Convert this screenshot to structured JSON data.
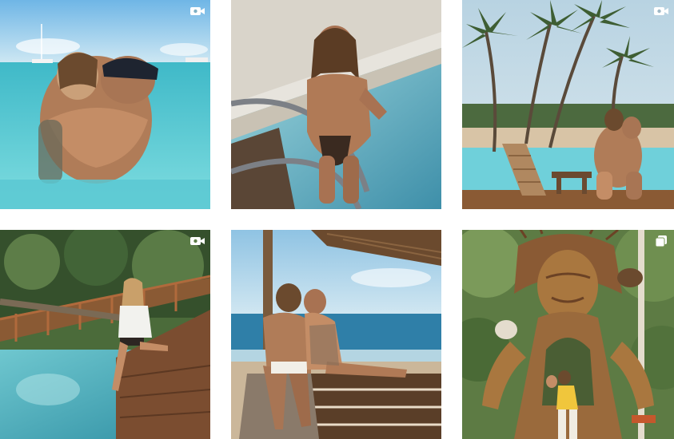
{
  "grid": {
    "posts": [
      {
        "scene": "couple-kissing-in-turquoise-sea",
        "badge": "video-icon"
      },
      {
        "scene": "woman-on-pool-ladder",
        "badge": ""
      },
      {
        "scene": "couple-at-palm-tree-pool",
        "badge": "video-icon"
      },
      {
        "scene": "woman-on-wooden-jungle-bridge",
        "badge": "video-icon"
      },
      {
        "scene": "couple-on-beach-deck",
        "badge": ""
      },
      {
        "scene": "couple-at-wooden-tree-sculpture",
        "badge": "carousel-icon"
      }
    ]
  },
  "colors": {
    "background": "#ffffff",
    "sea": "#4fc6cf",
    "pool": "#6fd0da",
    "sky": "#a9cde0",
    "wood": "#8a5a34",
    "jungle": "#4b6b3a",
    "skin": "#c48d66"
  }
}
